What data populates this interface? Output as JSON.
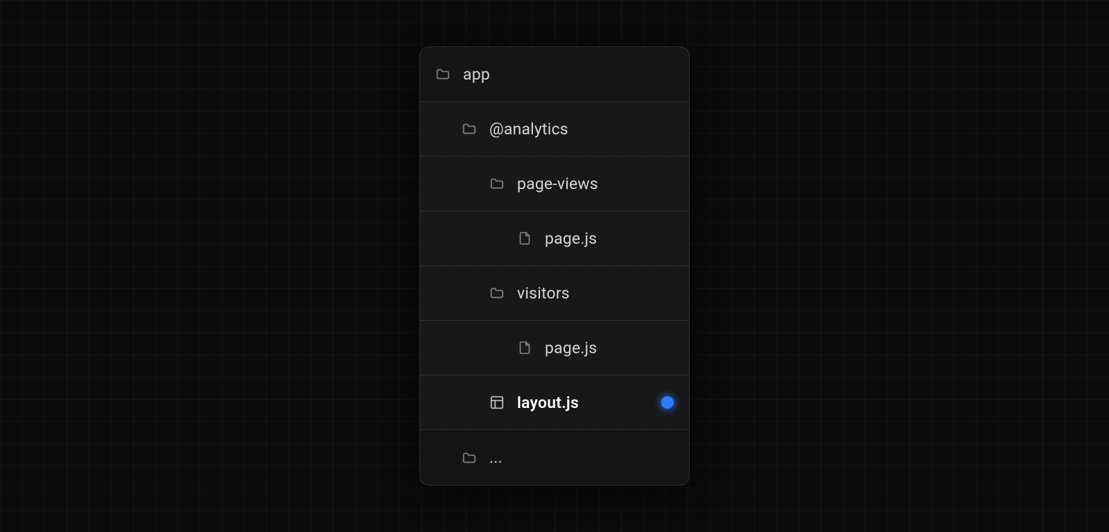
{
  "tree": {
    "root": {
      "label": "app"
    },
    "analytics": {
      "label": "@analytics"
    },
    "page_views": {
      "label": "page-views"
    },
    "page_views_file": {
      "label": "page.js"
    },
    "visitors": {
      "label": "visitors"
    },
    "visitors_file": {
      "label": "page.js"
    },
    "layout": {
      "label": "layout.js"
    },
    "more": {
      "label": "..."
    }
  }
}
